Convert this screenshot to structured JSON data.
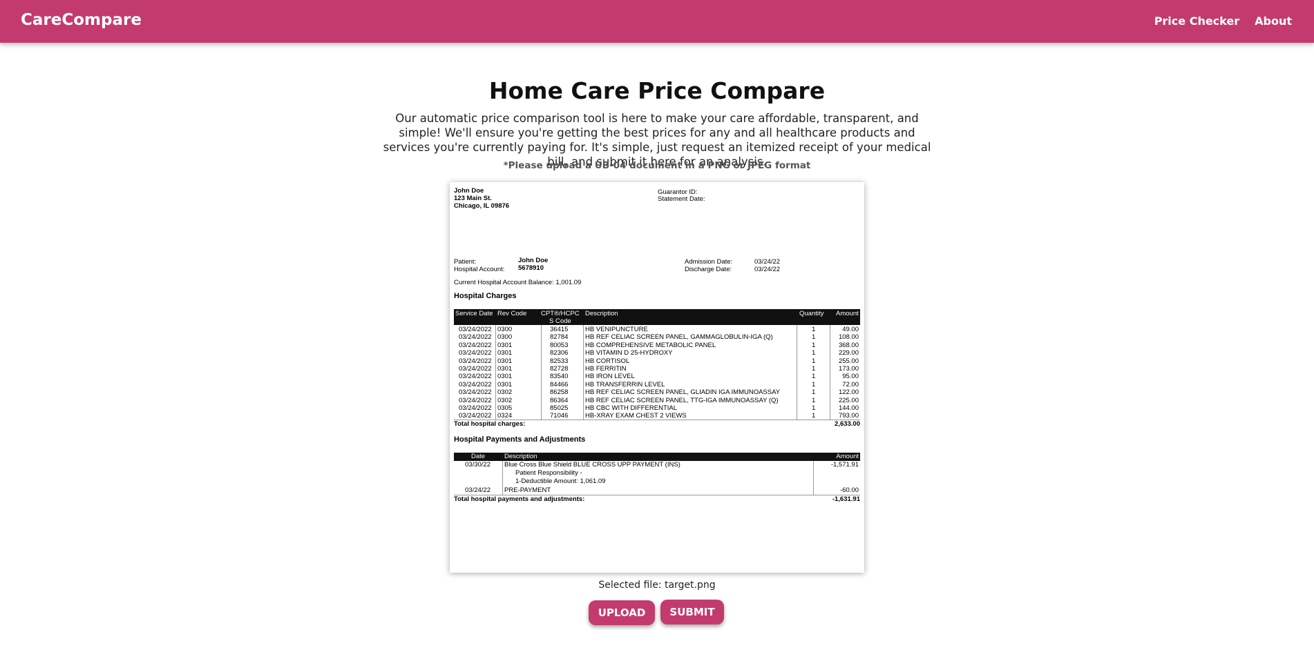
{
  "header": {
    "brand": "CareCompare",
    "nav": [
      {
        "label": "Price Checker"
      },
      {
        "label": "About"
      }
    ]
  },
  "main": {
    "title": "Home Care Price Compare",
    "intro": "Our automatic price comparison tool is here to make your care affordable, transparent, and simple! We'll ensure you're getting the best prices for any and all healthcare products and services you're currently paying for. It's simple, just request an itemized receipt of your medical bill, and submit it here for an analysis.",
    "note": "*Please upload a UB-04 document in a PNG or JPEG format",
    "selected_file": "Selected file: target.png",
    "upload_label": "UPLOAD",
    "submit_label": "SUBMIT"
  },
  "document": {
    "address": [
      "John Doe",
      "123 Main St.",
      "Chicago, IL 09876"
    ],
    "guarantor_label": "Guarantor ID:",
    "statement_label": "Statement Date:",
    "patient_label": "Patient:",
    "patient_value": "John Doe",
    "account_label": "Hospital Account:",
    "account_value": "5678910",
    "admission_label": "Admission Date:",
    "admission_value": "03/24/22",
    "discharge_label": "Discharge Date:",
    "discharge_value": "03/24/22",
    "balance": "Current Hospital Account Balance: 1,001.09",
    "charges_heading": "Hospital Charges",
    "charges_columns": [
      "Service Date",
      "Rev Code",
      "CPT®/HCPC",
      "S Code",
      "Description",
      "Quantity",
      "Amount"
    ],
    "charges_rows": [
      {
        "date": "03/24/2022",
        "rev": "0300",
        "cpt": "36415",
        "desc": "HB VENIPUNCTURE",
        "qty": "1",
        "amt": "49.00"
      },
      {
        "date": "03/24/2022",
        "rev": "0300",
        "cpt": "82784",
        "desc": "HB REF CELIAC SCREEN PANEL, GAMMAGLOBULIN-IGA (Q)",
        "qty": "1",
        "amt": "108.00"
      },
      {
        "date": "03/24/2022",
        "rev": "0301",
        "cpt": "80053",
        "desc": "HB COMPREHENSIVE METABOLIC PANEL",
        "qty": "1",
        "amt": "368.00"
      },
      {
        "date": "03/24/2022",
        "rev": "0301",
        "cpt": "82306",
        "desc": "HB VITAMIN D 25-HYDROXY",
        "qty": "1",
        "amt": "229.00"
      },
      {
        "date": "03/24/2022",
        "rev": "0301",
        "cpt": "82533",
        "desc": "HB CORTISOL",
        "qty": "1",
        "amt": "255.00"
      },
      {
        "date": "03/24/2022",
        "rev": "0301",
        "cpt": "82728",
        "desc": "HB FERRITIN",
        "qty": "1",
        "amt": "173.00"
      },
      {
        "date": "03/24/2022",
        "rev": "0301",
        "cpt": "83540",
        "desc": "HB IRON LEVEL",
        "qty": "1",
        "amt": "95.00"
      },
      {
        "date": "03/24/2022",
        "rev": "0301",
        "cpt": "84466",
        "desc": "HB TRANSFERRIN LEVEL",
        "qty": "1",
        "amt": "72.00"
      },
      {
        "date": "03/24/2022",
        "rev": "0302",
        "cpt": "86258",
        "desc": "HB REF CELIAC SCREEN PANEL, GLIADIN IGA IMMUNOASSAY",
        "qty": "1",
        "amt": "122.00"
      },
      {
        "date": "03/24/2022",
        "rev": "0302",
        "cpt": "86364",
        "desc": "HB REF CELIAC SCREEN PANEL, TTG-IGA IMMUNOASSAY (Q)",
        "qty": "1",
        "amt": "225.00"
      },
      {
        "date": "03/24/2022",
        "rev": "0305",
        "cpt": "85025",
        "desc": "HB CBC WITH DIFFERENTIAL",
        "qty": "1",
        "amt": "144.00"
      },
      {
        "date": "03/24/2022",
        "rev": "0324",
        "cpt": "71046",
        "desc": "HB-XRAY EXAM CHEST 2 VIEWS",
        "qty": "1",
        "amt": "793.00"
      }
    ],
    "total_charges_label": "Total hospital charges:",
    "total_charges_value": "2,633.00",
    "payments_heading": "Hospital Payments and Adjustments",
    "payments_columns": [
      "Date",
      "Description",
      "Amount"
    ],
    "payments_rows": [
      {
        "date": "03/30/22",
        "desc": "Blue Cross Blue Shield BLUE CROSS UPP PAYMENT (INS)",
        "amt": "-1,571.91"
      },
      {
        "date": "",
        "desc": "Patient Responsibility -",
        "amt": ""
      },
      {
        "date": "",
        "desc": "1-Deductible Amount: 1,061.09",
        "amt": ""
      },
      {
        "date": "03/24/22",
        "desc": "PRE-PAYMENT",
        "amt": "-60.00"
      }
    ],
    "total_payments_label": "Total hospital payments and adjustments:",
    "total_payments_value": "-1,631.91"
  }
}
